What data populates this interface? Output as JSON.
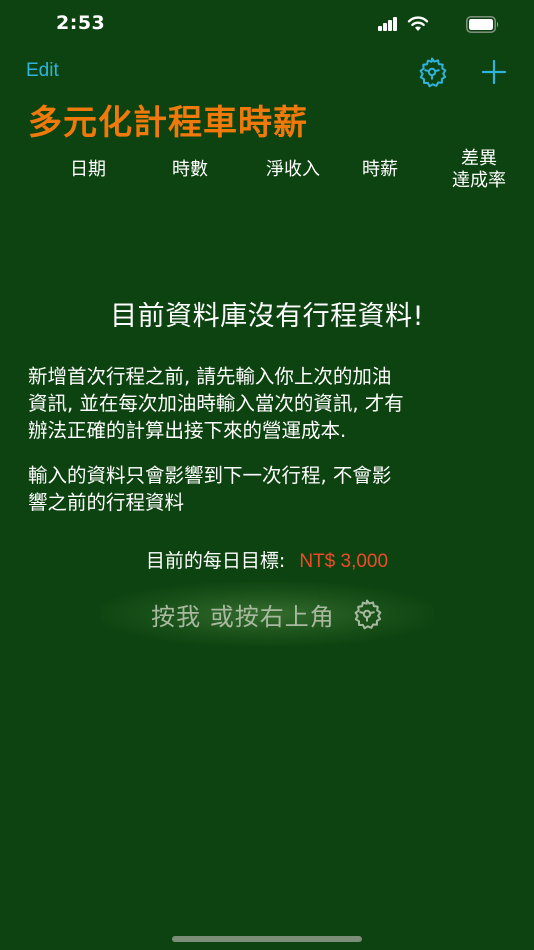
{
  "status": {
    "time": "2:53",
    "icons": [
      "signal-icon",
      "wifi-icon",
      "battery-icon"
    ]
  },
  "nav": {
    "edit_label": "Edit",
    "icons": [
      "gear-wheel-icon",
      "plus-icon"
    ]
  },
  "title": "多元化計程車時薪",
  "columns": {
    "date": "日期",
    "hours": "時數",
    "net_income": "淨收入",
    "hourly_rate": "時薪",
    "diff_rate": "差異\n達成率"
  },
  "empty_state": {
    "title": "目前資料庫沒有行程資料!",
    "paragraph_1": "新增首次行程之前, 請先輸入你上次的加油\n資訊, 並在每次加油時輸入當次的資訊, 才有\n辦法正確的計算出接下來的營運成本.",
    "paragraph_2": " 輸入的資料只會影響到下一次行程, 不會影\n響之前的行程資料",
    "goal_label": "目前的每日目標:",
    "goal_value": "NT$ 3,000",
    "button_label": "按我 或按右上角"
  },
  "colors": {
    "background": "#0d4310",
    "accent_blue": "#2fb3de",
    "title_orange": "#f0790c",
    "goal_red": "#f04a2a",
    "button_text": "#a8b9a0"
  }
}
